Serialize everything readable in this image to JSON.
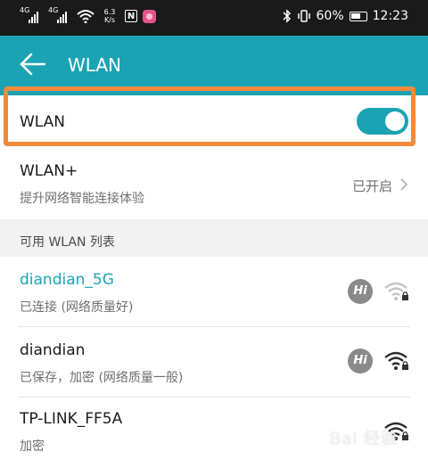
{
  "status_bar": {
    "sig1": "4G",
    "sig2": "4G",
    "speed_value": "6.3",
    "speed_unit": "K/s",
    "nfc": "N",
    "battery": "60%",
    "time": "12:23"
  },
  "header": {
    "title": "WLAN"
  },
  "wlan_toggle": {
    "label": "WLAN",
    "enabled": true
  },
  "wlan_plus": {
    "title": "WLAN+",
    "subtitle": "提升网络智能连接体验",
    "value": "已开启"
  },
  "section": {
    "label": "可用 WLAN 列表"
  },
  "networks": [
    {
      "ssid": "diandian_5G",
      "status": "已连接 (网络质量好)",
      "hi": "Hi",
      "connected_color": "#1ca3b3"
    },
    {
      "ssid": "diandian",
      "status": "已保存，加密 (网络质量一般)",
      "hi": "Hi"
    },
    {
      "ssid": "TP-LINK_FF5A",
      "status": "加密"
    }
  ],
  "colors": {
    "accent": "#1ca3b3",
    "highlight": "#f08a3c",
    "status_bar": "#1a1a1a"
  },
  "watermark": "Bai 经验"
}
